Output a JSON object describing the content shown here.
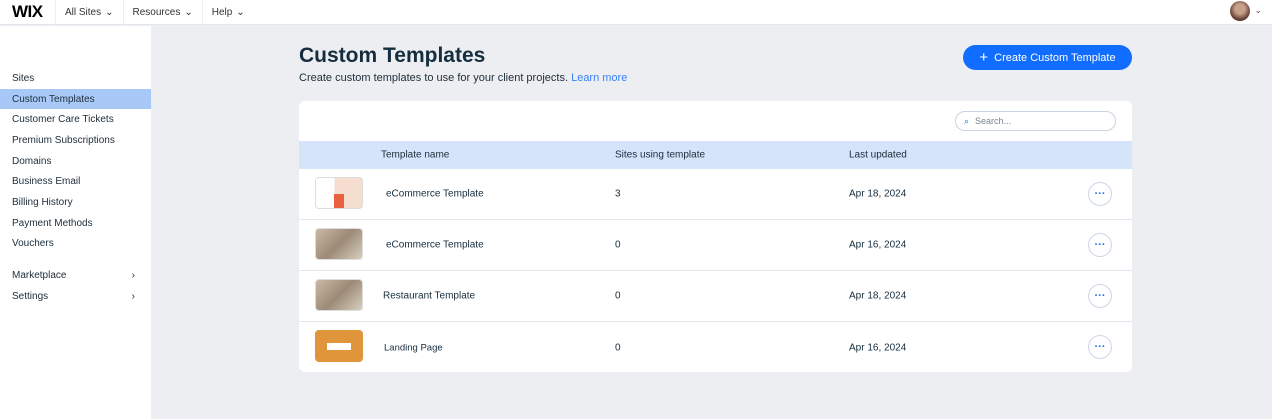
{
  "topbar": {
    "logo": "WIX",
    "nav": [
      "All Sites",
      "Resources",
      "Help"
    ]
  },
  "sidebar": {
    "items": [
      {
        "label": "Sites"
      },
      {
        "label": "Custom Templates"
      },
      {
        "label": "Customer Care Tickets"
      },
      {
        "label": "Premium Subscriptions"
      },
      {
        "label": "Domains"
      },
      {
        "label": "Business Email"
      },
      {
        "label": "Billing History"
      },
      {
        "label": "Payment Methods"
      },
      {
        "label": "Vouchers"
      }
    ],
    "groups": [
      {
        "label": "Marketplace"
      },
      {
        "label": "Settings"
      }
    ]
  },
  "page": {
    "title": "Custom Templates",
    "subtitle": "Create custom templates to use for your client projects.",
    "learn_more": "Learn more",
    "create_button": "Create Custom Template"
  },
  "table": {
    "search_placeholder": "Search...",
    "columns": [
      "Template name",
      "Sites using template",
      "Last updated"
    ],
    "rows": [
      {
        "name": "eCommerce Template",
        "sites": "3",
        "updated": "Apr 18, 2024"
      },
      {
        "name": "eCommerce Template",
        "sites": "0",
        "updated": "Apr 16, 2024"
      },
      {
        "name": "Restaurant Template",
        "sites": "0",
        "updated": "Apr 18, 2024"
      },
      {
        "name": "Landing Page",
        "sites": "0",
        "updated": "Apr 16, 2024"
      }
    ]
  },
  "colors": {
    "accent": "#116dff",
    "active_sidebar": "#a8c9f8",
    "table_header": "#d5e4fb"
  }
}
